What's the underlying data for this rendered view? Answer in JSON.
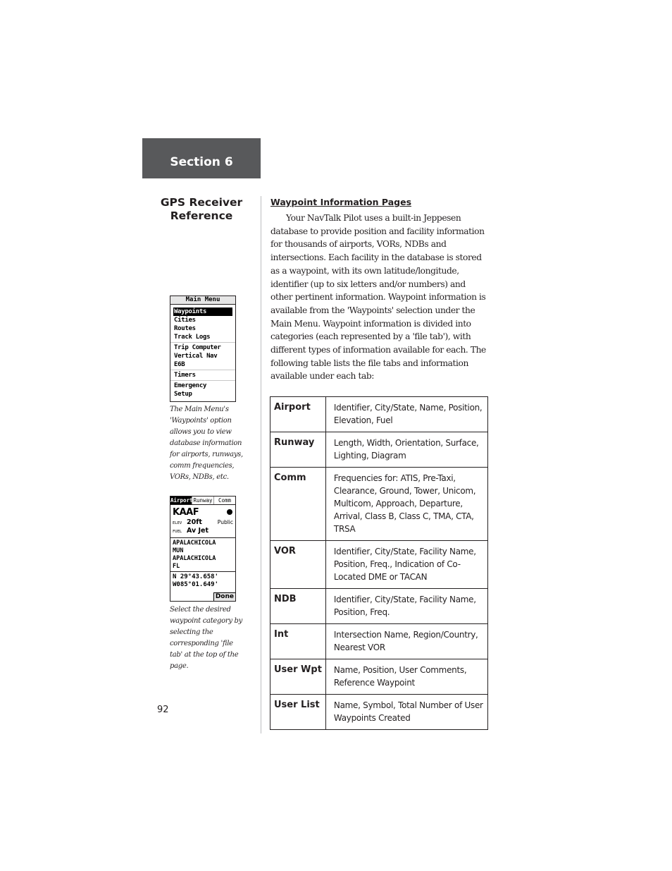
{
  "section": {
    "label": "Section 6"
  },
  "sidebar": {
    "title_line1": "GPS Receiver",
    "title_line2": "Reference",
    "page_number": "92"
  },
  "main_menu_screen": {
    "title": "Main Menu",
    "groups": [
      [
        "Waypoints",
        "Cities",
        "Routes",
        "Track Logs"
      ],
      [
        "Trip Computer",
        "Vertical Nav",
        "E6B"
      ],
      [
        "Timers"
      ],
      [
        "Emergency",
        "Setup"
      ]
    ],
    "selected": "Waypoints",
    "caption": "The Main Menu's 'Waypoints' option allows you to view database information for airports, runways, comm frequencies, VORs, NDBs, etc."
  },
  "waypoint_screen": {
    "tabs": [
      "Airport",
      "Runway",
      "Comm"
    ],
    "active_tab": "Airport",
    "identifier": "KAAF",
    "symbol_icon": "airport-symbol-icon",
    "elev_label": "ELEV",
    "elev_value": "20ft",
    "usage": "Public",
    "fuel_label": "FUEL",
    "fuel_value": "Av Jet",
    "name_lines": [
      "APALACHICOLA",
      "MUN",
      "APALACHICOLA",
      "FL"
    ],
    "lat": "N 29°43.658'",
    "lon": "W085°01.649'",
    "done_button": "Done",
    "caption": "Select the desired waypoint category by selecting the corresponding 'file tab' at the top of the page."
  },
  "content": {
    "heading": "Waypoint Information Pages",
    "paragraph": "Your NavTalk Pilot uses a built-in Jeppesen database to provide position and facility information for thousands of airports, VORs, NDBs and intersections.  Each facility in the database is stored as a waypoint, with its own latitude/longitude, identifier (up to six letters and/or numbers) and other pertinent information.  Waypoint information is available from the 'Waypoints' selection under the Main Menu.  Waypoint information is divided into categories (each represented by a 'file tab'), with different types of information available for each.  The following table lists the file tabs and information available under each tab:"
  },
  "table": {
    "rows": [
      {
        "tab": "Airport",
        "info": "Identifier, City/State, Name, Position, Elevation, Fuel"
      },
      {
        "tab": "Runway",
        "info": "Length, Width, Orientation, Surface, Lighting, Diagram"
      },
      {
        "tab": "Comm",
        "info": "Frequencies for:  ATIS, Pre-Taxi, Clearance, Ground, Tower, Unicom, Multicom, Approach, Departure, Arrival, Class B, Class C, TMA, CTA, TRSA"
      },
      {
        "tab": "VOR",
        "info": "Identifier, City/State, Facility Name, Position, Freq., Indication of Co-Located DME or TACAN"
      },
      {
        "tab": "NDB",
        "info": "Identifier, City/State, Facility Name, Position, Freq."
      },
      {
        "tab": "Int",
        "info": "Intersection Name, Region/Country, Nearest VOR"
      },
      {
        "tab": "User Wpt",
        "info": "Name, Position, User Comments, Reference Waypoint"
      },
      {
        "tab": "User List",
        "info": "Name, Symbol, Total Number of User Waypoints Created"
      }
    ]
  },
  "colors": {
    "section_bar": "#58595b",
    "text": "#231f20",
    "divider": "#bcbec0"
  }
}
